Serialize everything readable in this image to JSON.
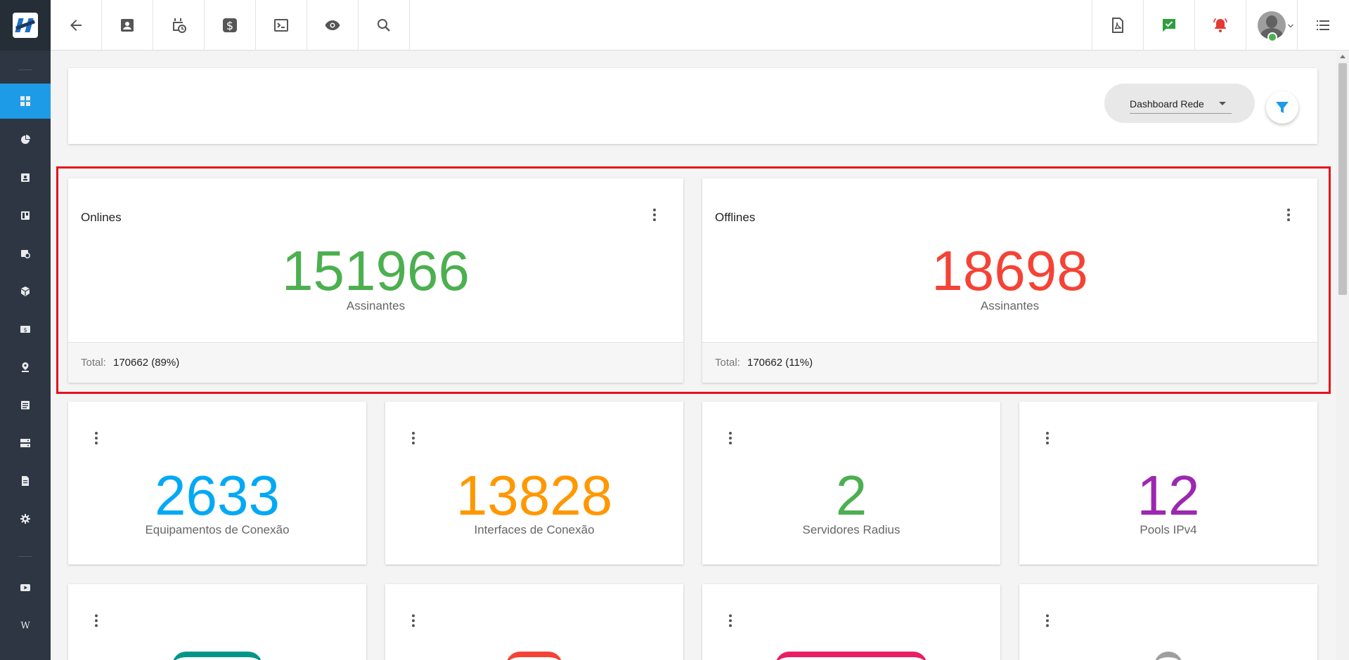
{
  "topbar": {
    "buttons": [
      {
        "name": "back",
        "icon": "arrow-back-icon"
      },
      {
        "name": "contacts",
        "icon": "contact-card-icon"
      },
      {
        "name": "scheduling",
        "icon": "calendar-clock-icon"
      },
      {
        "name": "financial",
        "icon": "dollar-icon"
      },
      {
        "name": "terminal",
        "icon": "terminal-icon"
      },
      {
        "name": "view",
        "icon": "eye-icon"
      },
      {
        "name": "search",
        "icon": "search-icon"
      }
    ],
    "right_buttons": [
      {
        "name": "pdf",
        "icon": "pdf-icon"
      },
      {
        "name": "tasks",
        "icon": "chat-check-icon",
        "color": "#2e9e3e"
      },
      {
        "name": "alerts",
        "icon": "bell-alert-icon",
        "color": "#e53935"
      },
      {
        "name": "user",
        "icon": "avatar"
      },
      {
        "name": "menu",
        "icon": "list-icon"
      }
    ]
  },
  "header": {
    "dashboard_select_value": "Dashboard Rede"
  },
  "cards": {
    "onlines": {
      "title": "Onlines",
      "value": "151966",
      "subtitle": "Assinantes",
      "total_label": "Total:",
      "total_value": "170662 (89%)",
      "color": "#4caf50"
    },
    "offlines": {
      "title": "Offlines",
      "value": "18698",
      "subtitle": "Assinantes",
      "total_label": "Total:",
      "total_value": "170662 (11%)",
      "color": "#f44336"
    },
    "equipamentos": {
      "value": "2633",
      "subtitle": "Equipamentos de Conexão",
      "color": "#03a9f4"
    },
    "interfaces": {
      "value": "13828",
      "subtitle": "Interfaces de Conexão",
      "color": "#ff9800"
    },
    "servidores": {
      "value": "2",
      "subtitle": "Servidores Radius",
      "color": "#4caf50"
    },
    "pools": {
      "value": "12",
      "subtitle": "Pools IPv4",
      "color": "#9c27b0"
    }
  },
  "colors": {
    "sidebar_bg": "#2d3642",
    "accent": "#1e9be6",
    "highlight_border": "#e8121b",
    "teal": "#009688",
    "red": "#f44336",
    "pink": "#e91e63",
    "grey": "#9e9e9e"
  },
  "sidebar": {
    "items": [
      {
        "name": "dashboard",
        "icon": "dashboard-icon",
        "active": true
      },
      {
        "name": "reports",
        "icon": "pie-chart-icon"
      },
      {
        "name": "contacts",
        "icon": "contact-card-icon"
      },
      {
        "name": "board",
        "icon": "board-icon"
      },
      {
        "name": "schedule",
        "icon": "calendar-clock-icon"
      },
      {
        "name": "inventory",
        "icon": "box-icon"
      },
      {
        "name": "financial",
        "icon": "money-icon"
      },
      {
        "name": "map",
        "icon": "map-pin-icon"
      },
      {
        "name": "documents",
        "icon": "document-list-icon"
      },
      {
        "name": "servers",
        "icon": "server-icon"
      },
      {
        "name": "files",
        "icon": "file-icon"
      },
      {
        "name": "settings",
        "icon": "gear-icon"
      },
      {
        "name": "videos",
        "icon": "play-icon"
      },
      {
        "name": "wiki",
        "icon": "wiki-icon",
        "text": "W"
      }
    ]
  }
}
